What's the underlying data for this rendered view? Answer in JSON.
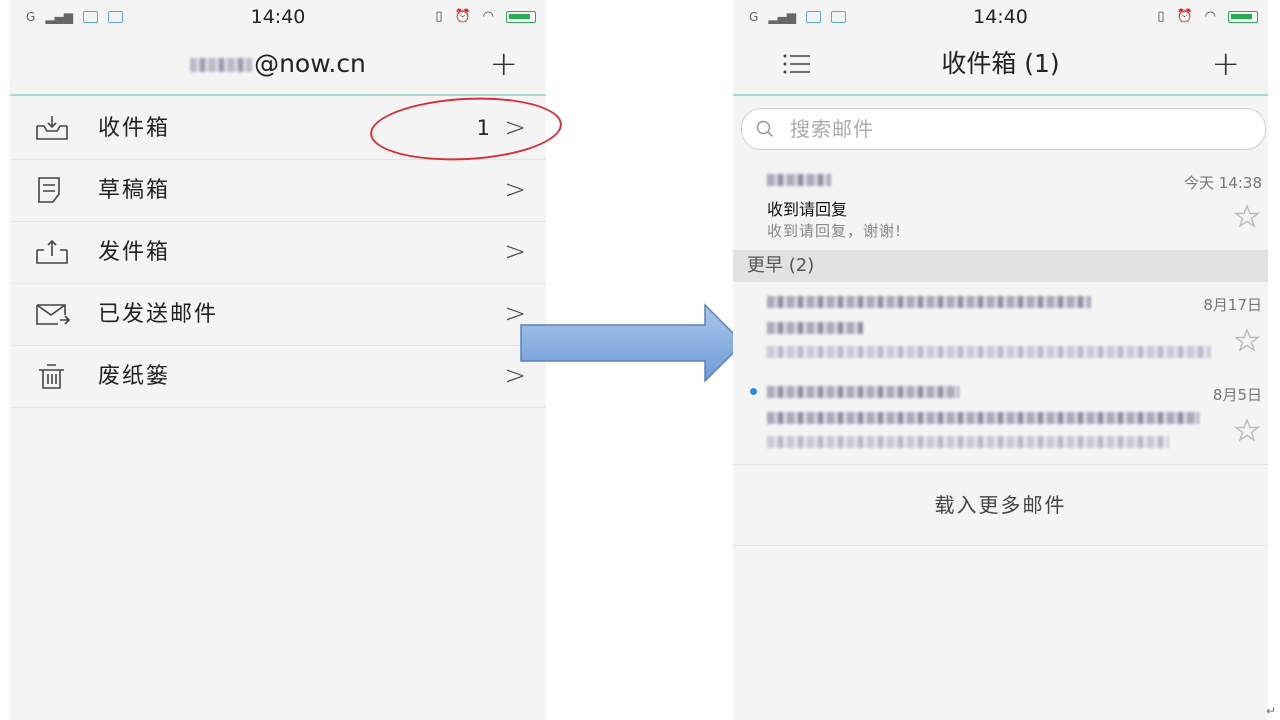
{
  "status_bar": {
    "time": "14:40",
    "carrier_mark": "G"
  },
  "left": {
    "header": {
      "account_suffix": "@now.cn",
      "add_label": "+"
    },
    "folders": [
      {
        "label": "收件箱",
        "count": "1",
        "icon": "inbox-icon"
      },
      {
        "label": "草稿箱",
        "count": "",
        "icon": "drafts-icon"
      },
      {
        "label": "发件箱",
        "count": "",
        "icon": "outbox-icon"
      },
      {
        "label": "已发送邮件",
        "count": "",
        "icon": "sent-icon"
      },
      {
        "label": "废纸篓",
        "count": "",
        "icon": "trash-icon"
      }
    ],
    "chevron": ">"
  },
  "right": {
    "header": {
      "title": "收件箱 (1)",
      "add_label": "+"
    },
    "search": {
      "placeholder": "搜索邮件"
    },
    "mails": [
      {
        "time": "今天 14:38",
        "subject": "收到请回复",
        "preview": "收到请回复，谢谢!",
        "unread": false
      },
      {
        "time": "8月17日",
        "unread": false
      },
      {
        "time": "8月5日",
        "unread": true
      }
    ],
    "section": {
      "label": "更早 (2)"
    },
    "load_more": "载入更多邮件"
  },
  "colors": {
    "accent_line": "#a9d8cf",
    "annotation_red": "#d8303a",
    "arrow_fill": "#8db3e2",
    "unread_dot": "#2b8be6"
  }
}
